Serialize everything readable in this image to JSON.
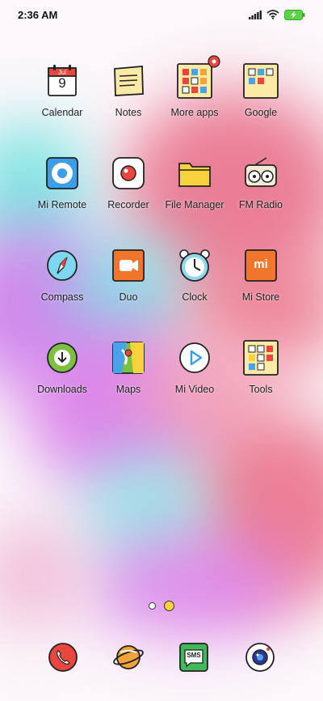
{
  "status": {
    "time": "2:36 AM"
  },
  "home": {
    "apps": [
      {
        "label": "Calendar",
        "icon": "calendar-icon",
        "calendar_month": "Jul",
        "calendar_day": "9"
      },
      {
        "label": "Notes",
        "icon": "notes-icon"
      },
      {
        "label": "More apps",
        "icon": "more-apps-folder-icon",
        "badge": true
      },
      {
        "label": "Google",
        "icon": "google-folder-icon"
      },
      {
        "label": "Mi Remote",
        "icon": "mi-remote-icon"
      },
      {
        "label": "Recorder",
        "icon": "recorder-icon"
      },
      {
        "label": "File Manager",
        "icon": "file-manager-icon"
      },
      {
        "label": "FM Radio",
        "icon": "fm-radio-icon"
      },
      {
        "label": "Compass",
        "icon": "compass-icon"
      },
      {
        "label": "Duo",
        "icon": "duo-icon"
      },
      {
        "label": "Clock",
        "icon": "clock-icon"
      },
      {
        "label": "Mi Store",
        "icon": "mi-store-icon",
        "logo_text": "mi"
      },
      {
        "label": "Downloads",
        "icon": "downloads-icon"
      },
      {
        "label": "Maps",
        "icon": "maps-icon"
      },
      {
        "label": "Mi Video",
        "icon": "mi-video-icon"
      },
      {
        "label": "Tools",
        "icon": "tools-folder-icon"
      }
    ],
    "page_indicator": {
      "total": 2,
      "current": 2
    }
  },
  "dock": [
    {
      "icon": "phone-icon"
    },
    {
      "icon": "browser-icon"
    },
    {
      "icon": "messaging-icon",
      "text": "SMS"
    },
    {
      "icon": "camera-icon"
    }
  ]
}
